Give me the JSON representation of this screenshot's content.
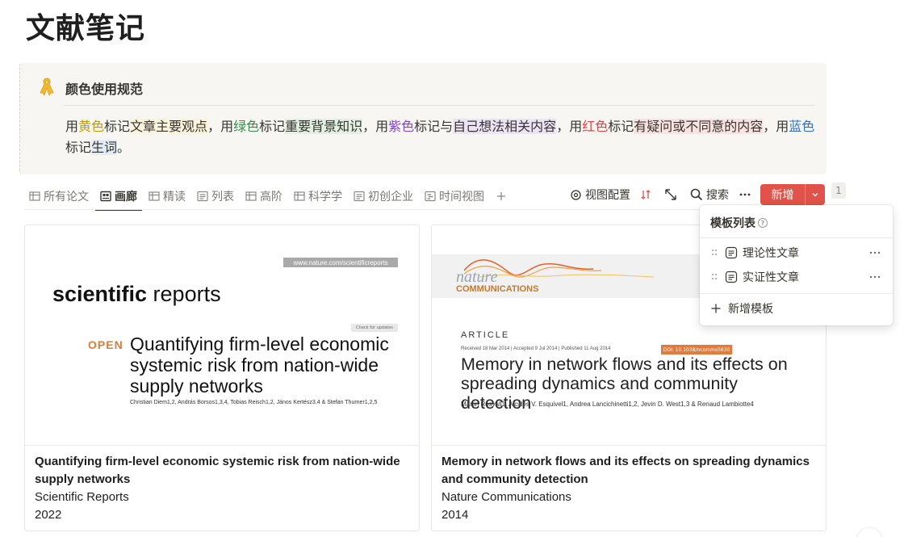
{
  "page": {
    "title": "文献笔记"
  },
  "callout": {
    "title": "颜色使用规范",
    "body": {
      "p1": "用",
      "yellow": "黄色",
      "p2": "标记",
      "yellow_bg": "文章主要观点",
      "p3": "，用",
      "green": "绿色",
      "p4": "标记",
      "green_bg": "重要背景知识",
      "p5": "，用",
      "purple": "紫色",
      "p6": "标记与",
      "purple_bg": "自己想法相关内容",
      "p7": "，用",
      "red": "红色",
      "p8": "标记",
      "red_bg": "有疑问或不同意的内容",
      "p9": "，用",
      "blue": "蓝色",
      "p10": "标记",
      "blue_bg": "生词",
      "p11": "。"
    }
  },
  "tabs": [
    {
      "label": "所有论文",
      "icon": "table-icon",
      "active": false
    },
    {
      "label": "画廊",
      "icon": "gallery-icon",
      "active": true
    },
    {
      "label": "精读",
      "icon": "table-icon",
      "active": false
    },
    {
      "label": "列表",
      "icon": "list-icon",
      "active": false
    },
    {
      "label": "高阶",
      "icon": "table-icon",
      "active": false
    },
    {
      "label": "科学学",
      "icon": "table-icon",
      "active": false
    },
    {
      "label": "初创企业",
      "icon": "list-icon",
      "active": false
    },
    {
      "label": "时间视图",
      "icon": "timeline-icon",
      "active": false
    }
  ],
  "toolbar": {
    "view_config": "视图配置",
    "search": "搜索",
    "new": "新增",
    "count": "1"
  },
  "cards": [
    {
      "cover": {
        "url": "www.nature.com/scientificreports",
        "logo_bold": "scientific",
        "logo_rest": " reports",
        "check": "Check for updates",
        "open": "OPEN",
        "title": "Quantifying firm-level economic systemic risk from nation-wide supply networks",
        "authors": "Christian Diem1,2, András Borsos1,3,4, Tobias Reisch1,2, János Kertész3,4 & Stefan Thurner1,2,5"
      },
      "title": "Quantifying firm-level economic systemic risk from nation-wide supply networks",
      "journal": "Scientific Reports",
      "year": "2022"
    },
    {
      "cover": {
        "logo_nature": "nature",
        "logo_comm": "COMMUNICATIONS",
        "label": "ARTICLE",
        "dates": "Received 18 Mar 2014 | Accepted 9 Jul 2014 | Published 11 Aug 2014",
        "doi": "DOI: 10.1038/ncomms5630",
        "title": "Memory in network flows and its effects on spreading dynamics and community detection",
        "authors": "Martin Rosvall1, Alcides V. Esquivel1, Andrea Lancichinetti1,2, Jevin D. West1,3 & Renaud Lambiotte4"
      },
      "title": "Memory in network flows and its effects on spreading dynamics and community detection",
      "journal": "Nature Communications",
      "year": "2014"
    }
  ],
  "dropdown": {
    "header": "模板列表",
    "items": [
      "理论性文章",
      "实证性文章"
    ],
    "add": "新增模板"
  },
  "colors": {
    "accent": "#e0524a",
    "yellow": "#c29a09",
    "green": "#3c8a4f",
    "purple": "#8a43c9",
    "red": "#d44c47",
    "blue": "#2f73c0"
  }
}
